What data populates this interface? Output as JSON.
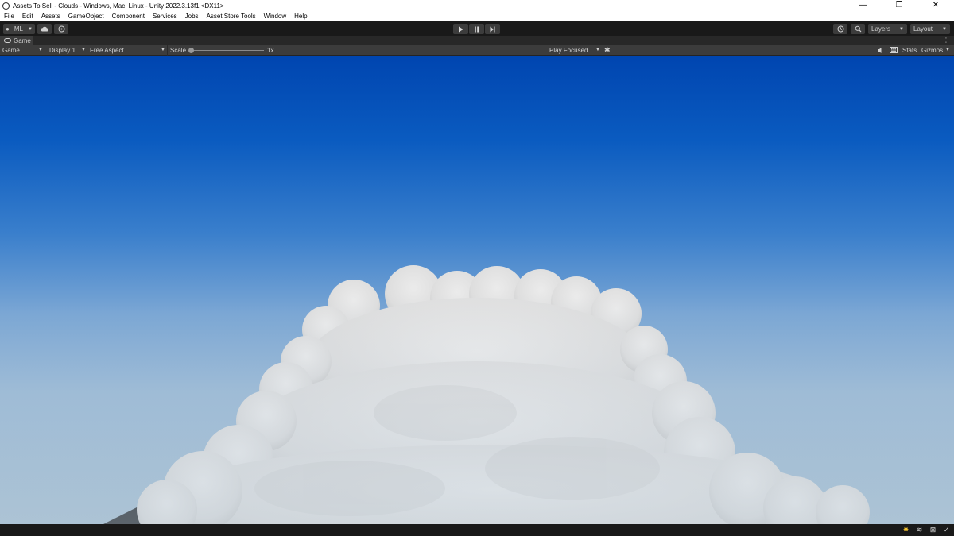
{
  "window": {
    "title": "Assets To Sell - Clouds - Windows, Mac, Linux - Unity 2022.3.13f1 <DX11>",
    "minimize_glyph": "—",
    "restore_glyph": "❐",
    "close_glyph": "✕"
  },
  "menu": [
    "File",
    "Edit",
    "Assets",
    "GameObject",
    "Component",
    "Services",
    "Jobs",
    "Asset Store Tools",
    "Window",
    "Help"
  ],
  "toolbar": {
    "account_label": "ML",
    "layers_label": "Layers",
    "layout_label": "Layout"
  },
  "tab": {
    "game_label": "Game"
  },
  "game_view": {
    "mode": "Game",
    "display": "Display 1",
    "aspect": "Free Aspect",
    "scale_label": "Scale",
    "scale_value": "1x",
    "play_mode": "Play Focused",
    "stats_label": "Stats",
    "gizmos_label": "Gizmos"
  },
  "colors": {
    "editor_bg": "#191919",
    "panel": "#3c3c3c",
    "sky_top": "#0045b0",
    "sky_horizon": "#a8c1d4",
    "cloud": "#e6e6e6",
    "warning": "#f2c230"
  }
}
